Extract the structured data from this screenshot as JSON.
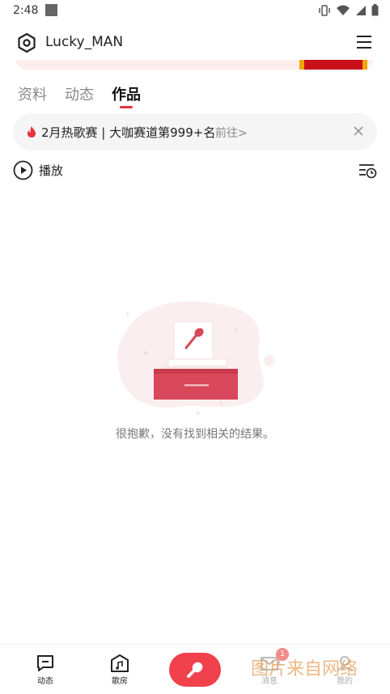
{
  "status_bar": {
    "time": "2:48"
  },
  "header": {
    "username": "Lucky_MAN"
  },
  "tabs": [
    {
      "label": "资料",
      "active": false
    },
    {
      "label": "动态",
      "active": false
    },
    {
      "label": "作品",
      "active": true
    }
  ],
  "notice": {
    "text": "2月热歌赛 | 大咖赛道第999+名",
    "link": "前往>"
  },
  "play": {
    "label": "播放"
  },
  "empty_state": {
    "message": "很抱歉，没有找到相关的结果。"
  },
  "bottom_nav": {
    "items": [
      {
        "label": "动态",
        "icon": "chat-icon"
      },
      {
        "label": "歌房",
        "icon": "music-room-icon"
      },
      {
        "label": "消息",
        "icon": "mail-icon"
      },
      {
        "label": "我的",
        "icon": "profile-icon"
      }
    ],
    "message_badge": "1"
  },
  "watermark": "图片来自网络",
  "colors": {
    "accent": "#f0414c",
    "tab_underline": "#e9303e",
    "illustration_red": "#d9475a"
  }
}
